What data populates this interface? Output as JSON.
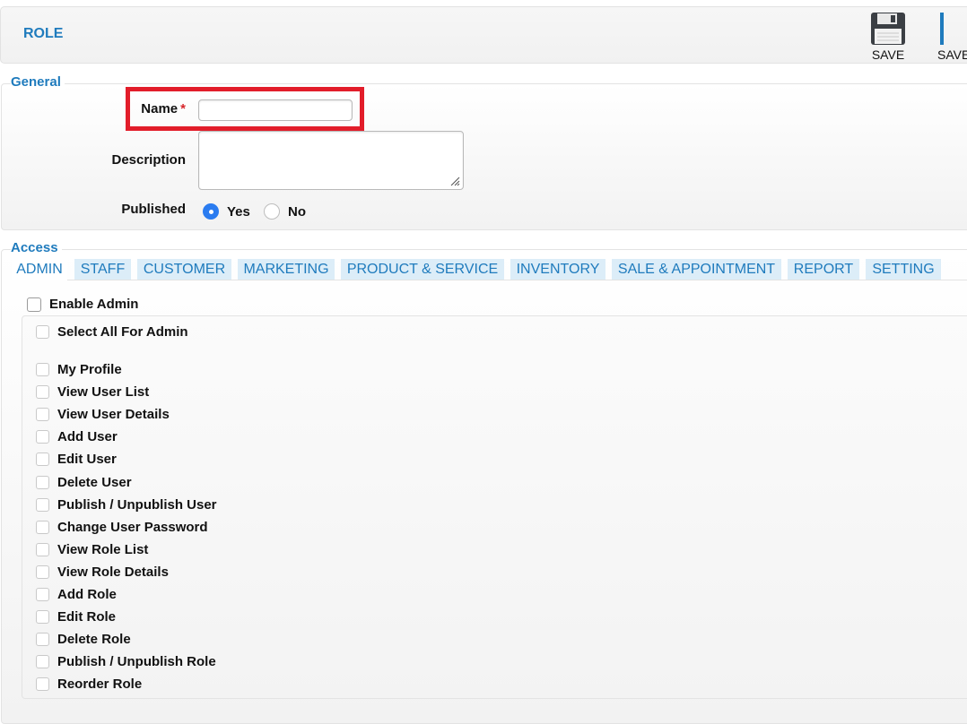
{
  "header": {
    "title": "ROLE",
    "buttons": [
      {
        "label": "SAVE"
      },
      {
        "label": "SAVE"
      }
    ]
  },
  "general": {
    "legend": "General",
    "name_label": "Name",
    "required_mark": "*",
    "name_value": "",
    "description_label": "Description",
    "description_value": "",
    "published_label": "Published",
    "published_options": [
      {
        "label": "Yes",
        "selected": true
      },
      {
        "label": "No",
        "selected": false
      }
    ]
  },
  "access": {
    "legend": "Access",
    "tabs": [
      {
        "label": "ADMIN",
        "active": true
      },
      {
        "label": "STAFF"
      },
      {
        "label": "CUSTOMER"
      },
      {
        "label": "MARKETING"
      },
      {
        "label": "PRODUCT & SERVICE"
      },
      {
        "label": "INVENTORY"
      },
      {
        "label": "SALE & APPOINTMENT"
      },
      {
        "label": "REPORT"
      },
      {
        "label": "SETTING"
      }
    ],
    "enable_label": "Enable Admin",
    "select_all_label": "Select All For Admin",
    "permissions": [
      "My Profile",
      "View User List",
      "View User Details",
      "Add User",
      "Edit User",
      "Delete User",
      "Publish / Unpublish User",
      "Change User Password",
      "View Role List",
      "View Role Details",
      "Add Role",
      "Edit Role",
      "Delete Role",
      "Publish / Unpublish Role",
      "Reorder Role"
    ]
  },
  "colors": {
    "accent": "#1f7bbd",
    "tab_bg": "#dcedf8",
    "highlight": "#e21d2a",
    "radio_on": "#2b7cf0"
  },
  "icons": {
    "save": "floppy-disk-icon"
  }
}
